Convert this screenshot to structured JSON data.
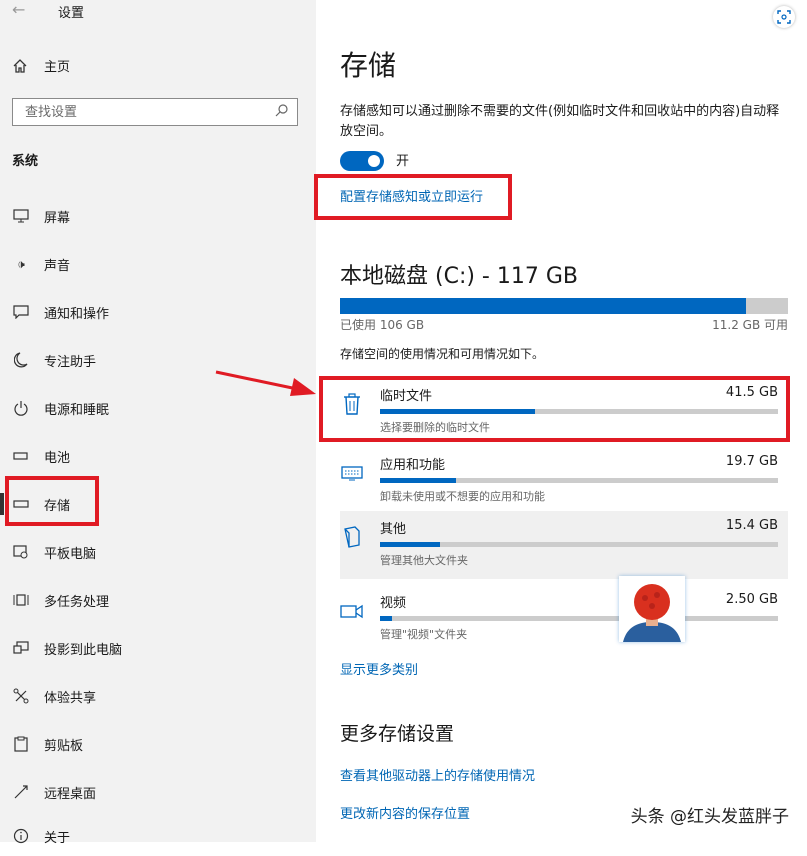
{
  "window": {
    "title": "设置"
  },
  "sidebar": {
    "home_label": "主页",
    "search_placeholder": "查找设置",
    "section_label": "系统",
    "items": [
      {
        "label": "屏幕",
        "icon": "monitor-icon"
      },
      {
        "label": "声音",
        "icon": "speaker-icon"
      },
      {
        "label": "通知和操作",
        "icon": "notification-icon"
      },
      {
        "label": "专注助手",
        "icon": "moon-icon"
      },
      {
        "label": "电源和睡眠",
        "icon": "power-icon"
      },
      {
        "label": "电池",
        "icon": "battery-icon"
      },
      {
        "label": "存储",
        "icon": "storage-icon",
        "active": true
      },
      {
        "label": "平板电脑",
        "icon": "tablet-icon"
      },
      {
        "label": "多任务处理",
        "icon": "multitask-icon"
      },
      {
        "label": "投影到此电脑",
        "icon": "projector-icon"
      },
      {
        "label": "体验共享",
        "icon": "share-icon"
      },
      {
        "label": "剪贴板",
        "icon": "clipboard-icon"
      },
      {
        "label": "远程桌面",
        "icon": "remote-desktop-icon"
      },
      {
        "label": "关于",
        "icon": "info-icon"
      }
    ]
  },
  "main": {
    "title": "存储",
    "description": "存储感知可以通过删除不需要的文件(例如临时文件和回收站中的内容)自动释放空间。",
    "toggle": {
      "state_label": "开",
      "on": true
    },
    "configure_link": "配置存储感知或立即运行",
    "disk": {
      "title": "本地磁盘 (C:) - 117 GB",
      "used_label": "已使用 106 GB",
      "available_label": "11.2 GB 可用",
      "used_fraction": 0.906
    },
    "usage_description": "存储空间的使用情况和可用情况如下。",
    "categories": [
      {
        "name": "临时文件",
        "size": "41.5 GB",
        "subtitle": "选择要删除的临时文件",
        "fraction": 0.39,
        "icon": "trash-icon"
      },
      {
        "name": "应用和功能",
        "size": "19.7 GB",
        "subtitle": "卸载未使用或不想要的应用和功能",
        "fraction": 0.19,
        "icon": "keyboard-icon"
      },
      {
        "name": "其他",
        "size": "15.4 GB",
        "subtitle": "管理其他大文件夹",
        "fraction": 0.15,
        "icon": "document-icon"
      },
      {
        "name": "视频",
        "size": "2.50 GB",
        "subtitle": "管理\"视频\"文件夹",
        "fraction": 0.03,
        "icon": "video-icon"
      }
    ],
    "show_more_link": "显示更多类别",
    "more_settings_title": "更多存储设置",
    "links": [
      "查看其他驱动器上的存储使用情况",
      "更改新内容的保存位置"
    ]
  },
  "watermark": "头条 @红头发蓝胖子",
  "colors": {
    "accent": "#0067c0",
    "highlight": "#e01b24",
    "sidebar_bg": "#f2f2f2"
  }
}
